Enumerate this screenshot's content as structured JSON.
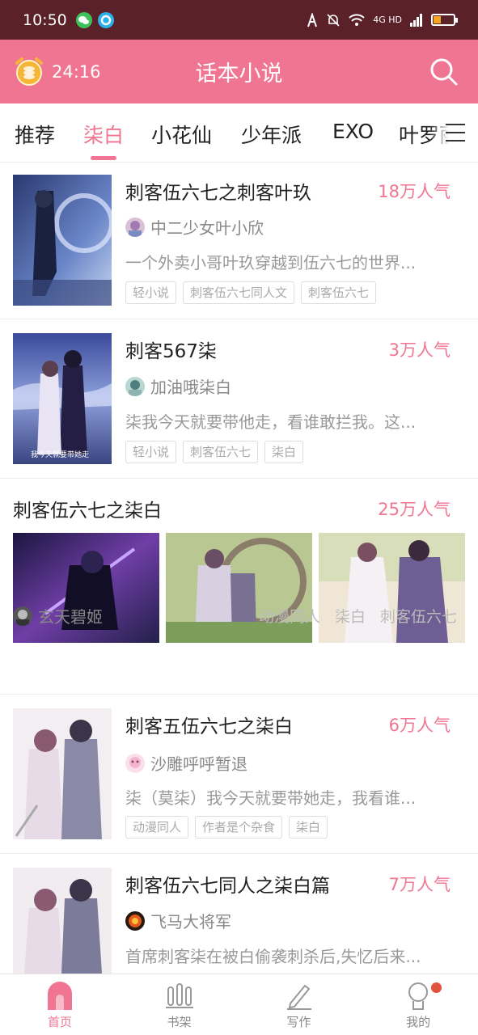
{
  "status_bar": {
    "time": "10:50",
    "network": "4G HD"
  },
  "header": {
    "timer": "24:16",
    "title": "话本小说"
  },
  "tabs": [
    {
      "label": "推荐"
    },
    {
      "label": "柒白"
    },
    {
      "label": "小花仙"
    },
    {
      "label": "少年派"
    },
    {
      "label": "EXO"
    },
    {
      "label": "叶罗丽"
    }
  ],
  "stories": [
    {
      "title": "刺客伍六七之刺客叶玖",
      "popularity": "18万人气",
      "author": "中二少女叶小欣",
      "description": "一个外卖小哥叶玖穿越到伍六七的世界...",
      "tags": [
        "轻小说",
        "刺客伍六七同人文",
        "刺客伍六七"
      ]
    },
    {
      "title": "刺客567柒",
      "popularity": "3万人气",
      "author": "加油哦柒白",
      "description": "柒我今天就要带他走，看谁敢拦我。这...",
      "tags": [
        "轻小说",
        "刺客伍六七",
        "柒白"
      ],
      "cover_caption": "我今天就要带她走"
    },
    {
      "title": "刺客伍六七之柒白",
      "popularity": "25万人气",
      "author": "玄天碧姬",
      "tags": [
        "动漫同人",
        "柒白",
        "刺客伍六七"
      ]
    },
    {
      "title": "刺客五伍六七之柒白",
      "popularity": "6万人气",
      "author": "沙雕呼呼暂退",
      "description": "柒（莫柒）我今天就要带她走，我看谁...",
      "tags": [
        "动漫同人",
        "作者是个杂食",
        "柒白"
      ]
    },
    {
      "title": "刺客伍六七同人之柒白篇",
      "popularity": "7万人气",
      "author": "飞马大将军",
      "description": "首席刺客柒在被白偷袭刺杀后,失忆后来..."
    }
  ],
  "bottom_nav": [
    {
      "label": "首页",
      "icon": "home-icon"
    },
    {
      "label": "书架",
      "icon": "bookshelf-icon"
    },
    {
      "label": "写作",
      "icon": "pen-icon"
    },
    {
      "label": "我的",
      "icon": "profile-icon"
    }
  ],
  "colors": {
    "accent": "#f07592",
    "status_bar": "#5a2228",
    "badge": "#e0523a"
  }
}
